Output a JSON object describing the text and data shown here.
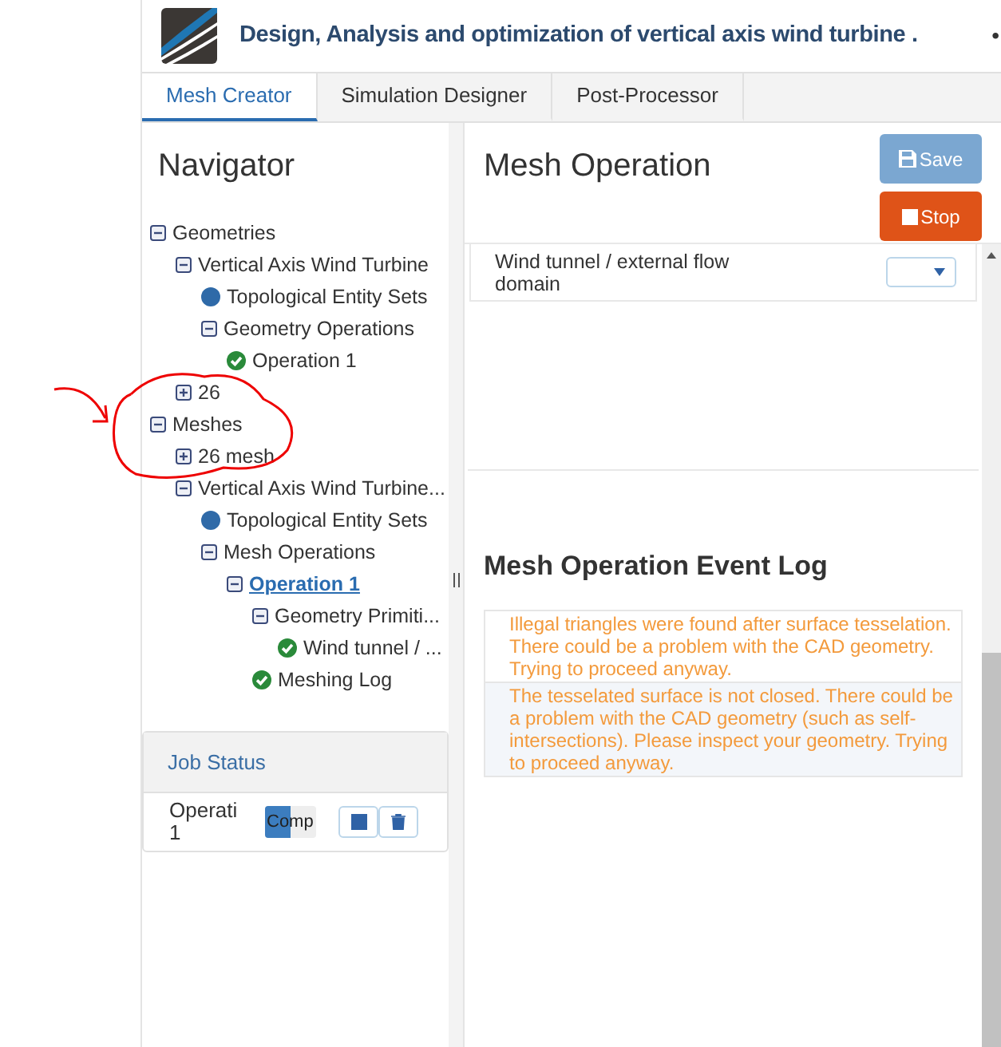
{
  "header": {
    "title": "Design, Analysis and optimization of vertical axis wind turbine .",
    "edge_mark": "•"
  },
  "tabs": [
    {
      "label": "Mesh Creator",
      "selected": true
    },
    {
      "label": "Simulation Designer",
      "selected": false
    },
    {
      "label": "Post-Processor",
      "selected": false
    }
  ],
  "navigator": {
    "title": "Navigator",
    "tree": [
      {
        "label": "Geometries",
        "kind": "toggle",
        "expanded": true,
        "children": [
          {
            "label": "Vertical Axis Wind Turbine",
            "kind": "toggle",
            "expanded": true,
            "children": [
              {
                "label": "Topological Entity Sets",
                "kind": "dot"
              },
              {
                "label": "Geometry Operations",
                "kind": "toggle",
                "expanded": true,
                "children": [
                  {
                    "label": "Operation 1",
                    "kind": "check"
                  }
                ]
              }
            ]
          },
          {
            "label": "26",
            "kind": "toggle",
            "expanded": false
          }
        ]
      },
      {
        "label": "Meshes",
        "kind": "toggle",
        "expanded": true,
        "children": [
          {
            "label": "26 mesh",
            "kind": "toggle",
            "expanded": false
          },
          {
            "label": "Vertical Axis Wind Turbine...",
            "kind": "toggle",
            "expanded": true,
            "children": [
              {
                "label": "Topological Entity Sets",
                "kind": "dot"
              },
              {
                "label": "Mesh Operations",
                "kind": "toggle",
                "expanded": true,
                "children": [
                  {
                    "label": "Operation 1",
                    "kind": "toggle",
                    "expanded": true,
                    "selected": true,
                    "children": [
                      {
                        "label": "Geometry Primiti...",
                        "kind": "toggle",
                        "expanded": true,
                        "children": [
                          {
                            "label": "Wind tunnel / ...",
                            "kind": "check"
                          }
                        ]
                      },
                      {
                        "label": "Meshing Log",
                        "kind": "check"
                      }
                    ]
                  }
                ]
              }
            ]
          }
        ]
      }
    ]
  },
  "job_status": {
    "title": "Job Status",
    "rows": [
      {
        "name": "Operati 1",
        "progress": {
          "label": "Comp",
          "level": 0.5
        }
      }
    ]
  },
  "mesh_operation": {
    "title": "Mesh Operation",
    "buttons": [
      {
        "label": "Save",
        "kind": "save",
        "disabled": true
      },
      {
        "label": "Stop",
        "kind": "stop",
        "disabled": false
      }
    ],
    "fields": [
      {
        "label": "Wind tunnel / external flow domain"
      }
    ]
  },
  "event_log": {
    "title": "Mesh Operation Event Log",
    "entries": [
      {
        "text": "Illegal triangles were found after surface tesselation. There could be a problem with the CAD geometry. Trying to proceed anyway."
      },
      {
        "text": "The tesselated surface is not closed. There could be a problem with the CAD geometry (such as self-intersections). Please inspect your geometry. Trying to proceed anyway."
      }
    ]
  }
}
